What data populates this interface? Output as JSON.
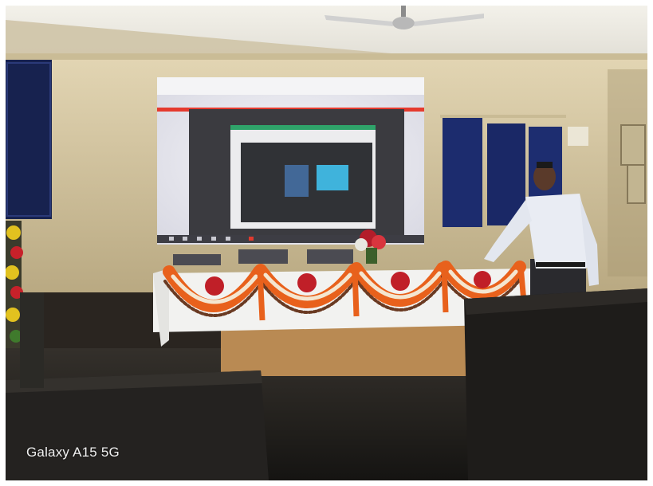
{
  "photo": {
    "watermark": "Galaxy A15 5G",
    "colors": {
      "ceiling": "#e9e6dd",
      "wall": "#d9cba6",
      "projection": "#e8e8ee",
      "window_panel": "#1c2c6e",
      "garland_orange": "#e8611c",
      "table_cloth": "#f2f2f0",
      "floor": "#1f1d1a"
    }
  }
}
